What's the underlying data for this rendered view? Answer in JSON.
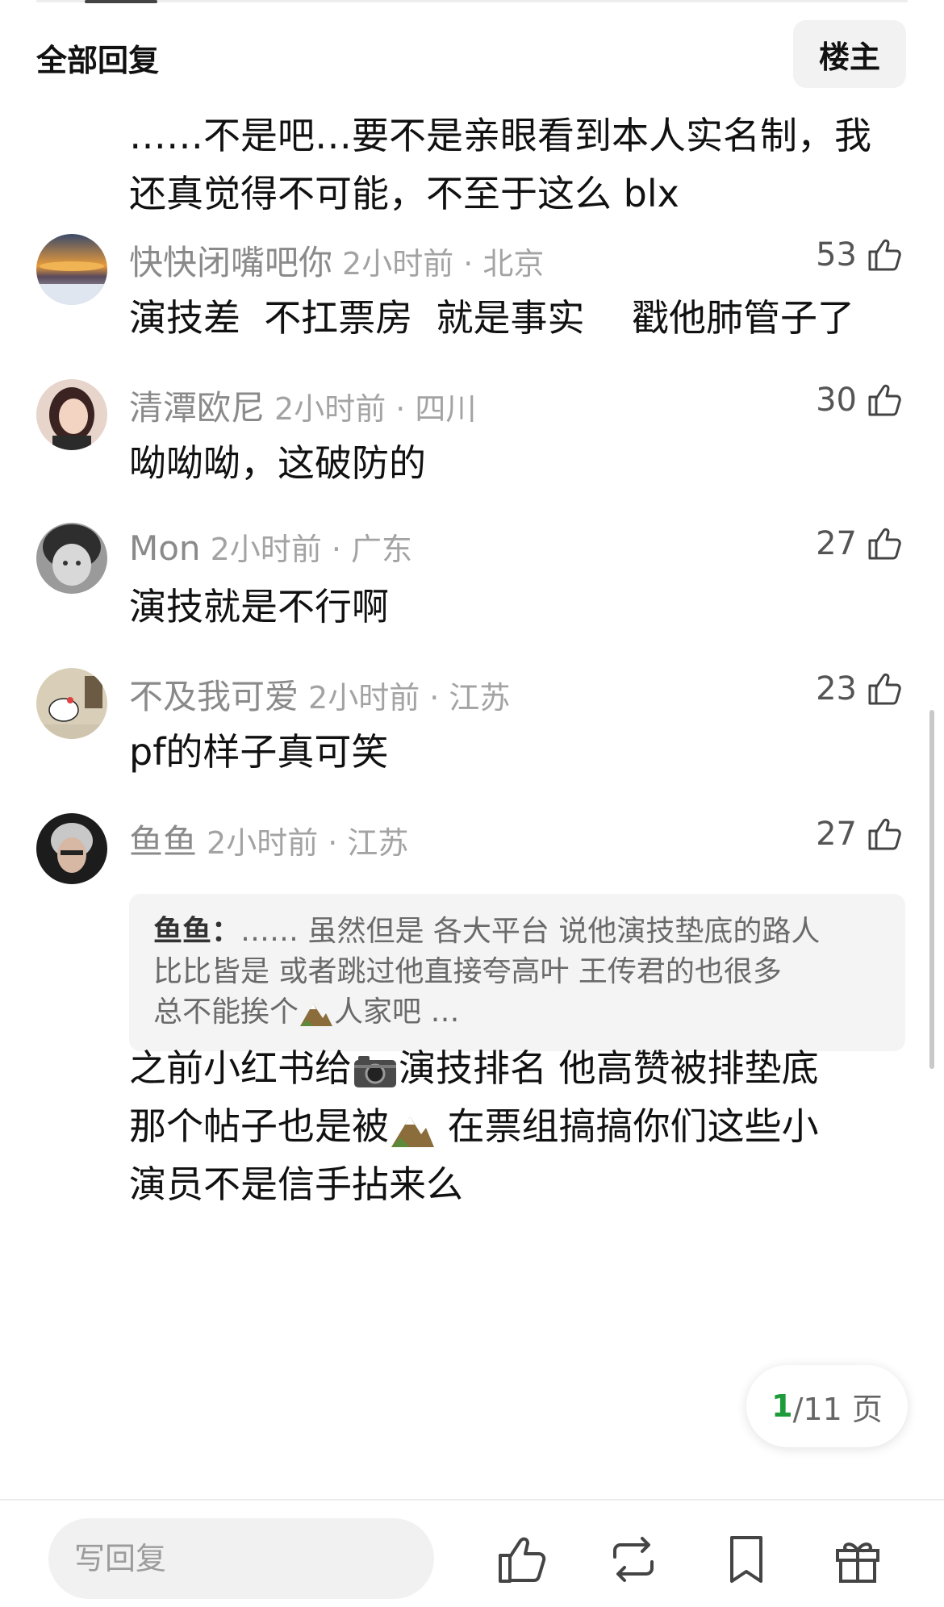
{
  "header": {
    "title": "全部回复",
    "owner_button": "楼主"
  },
  "first_comment_text": "……不是吧…要不是亲眼看到本人实名制，我还真觉得不可能，不至于这么 blx",
  "comments": [
    {
      "name": "快快闭嘴吧你",
      "meta": "2小时前 · 北京",
      "likes": "53",
      "text": "演技差  不扛票房  就是事实    戳他肺管子了",
      "avatar": "sunset-avatar"
    },
    {
      "name": "清潭欧尼",
      "meta": "2小时前 · 四川",
      "likes": "30",
      "text": "呦呦呦，这破防的",
      "avatar": "girl-avatar"
    },
    {
      "name": "Mon",
      "meta": "2小时前 · 广东",
      "likes": "27",
      "text": "演技就是不行啊",
      "avatar": "child-avatar"
    },
    {
      "name": "不及我可爱",
      "meta": "2小时前 · 江苏",
      "likes": "23",
      "text": "pf的样子真可笑",
      "avatar": "hello-kitty-avatar"
    },
    {
      "name": "鱼鱼",
      "meta": "2小时前 · 江苏",
      "likes": "27",
      "text": "",
      "avatar": "dark-portrait-avatar"
    }
  ],
  "quote": {
    "author": "鱼鱼：",
    "line1": "…… 虽然但是 各大平台 说他演技垫底的路人",
    "line2": "比比皆是 或者跳过他直接夸高叶 王传君的也很多",
    "line3_a": "总不能挨个",
    "line3_b": "人家吧 …"
  },
  "long_reply": {
    "part1": "之前小红书给",
    "part2": "演技排名 他高赞被排垫底",
    "part3": "那个帖子也是被",
    "part4": " 在票组搞搞你们这些小",
    "part5": "演员不是信手拈来么"
  },
  "pager": {
    "current": "1",
    "total": "/11 页"
  },
  "bottom_bar": {
    "reply_placeholder": "写回复"
  },
  "colors": {
    "accent_green": "#1e9b3a",
    "meta_gray": "#8a8a8a"
  }
}
